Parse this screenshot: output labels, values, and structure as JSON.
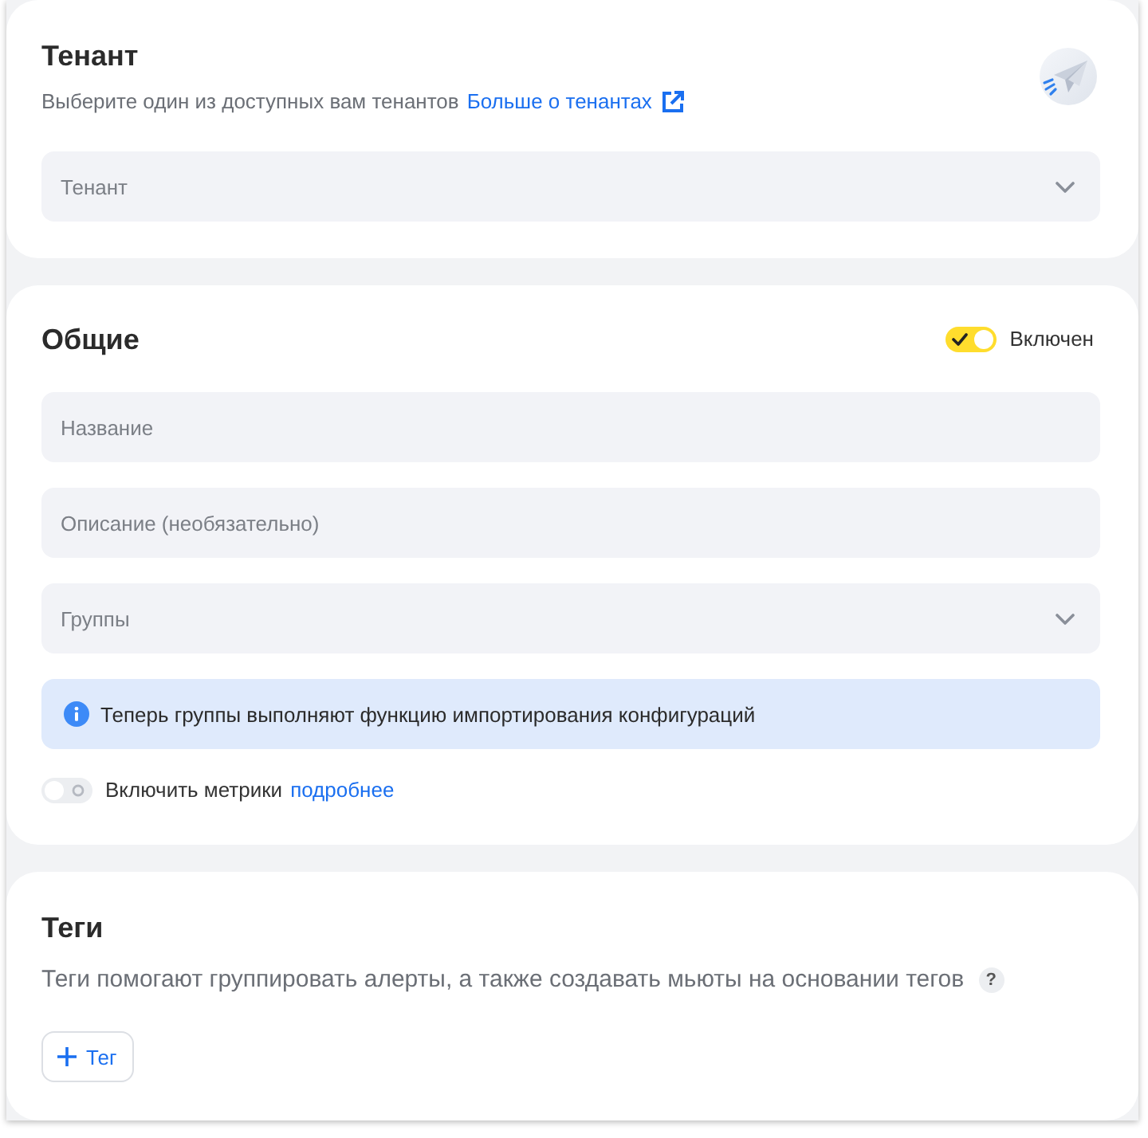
{
  "tenant_section": {
    "title": "Тенант",
    "subtitle": "Выберите один из доступных вам тенантов",
    "link": "Больше о тенантах",
    "select": {
      "placeholder": "Тенант"
    }
  },
  "general_section": {
    "title": "Общие",
    "enabled_toggle": {
      "label": "Включен",
      "on": true
    },
    "fields": [
      {
        "kind": "input",
        "placeholder": "Название"
      },
      {
        "kind": "input",
        "placeholder": "Описание (необязательно)"
      },
      {
        "kind": "select",
        "placeholder": "Группы"
      }
    ],
    "info_banner": "Теперь группы выполняют функцию импортирования конфигураций",
    "metrics_toggle": {
      "label": "Включить метрики",
      "link": "подробнее",
      "on": false
    }
  },
  "tags_section": {
    "title": "Теги",
    "description": "Теги помогают группировать алерты, а также создавать мьюты на основании тегов",
    "help_mark": "?",
    "add_button": "Тег"
  }
}
